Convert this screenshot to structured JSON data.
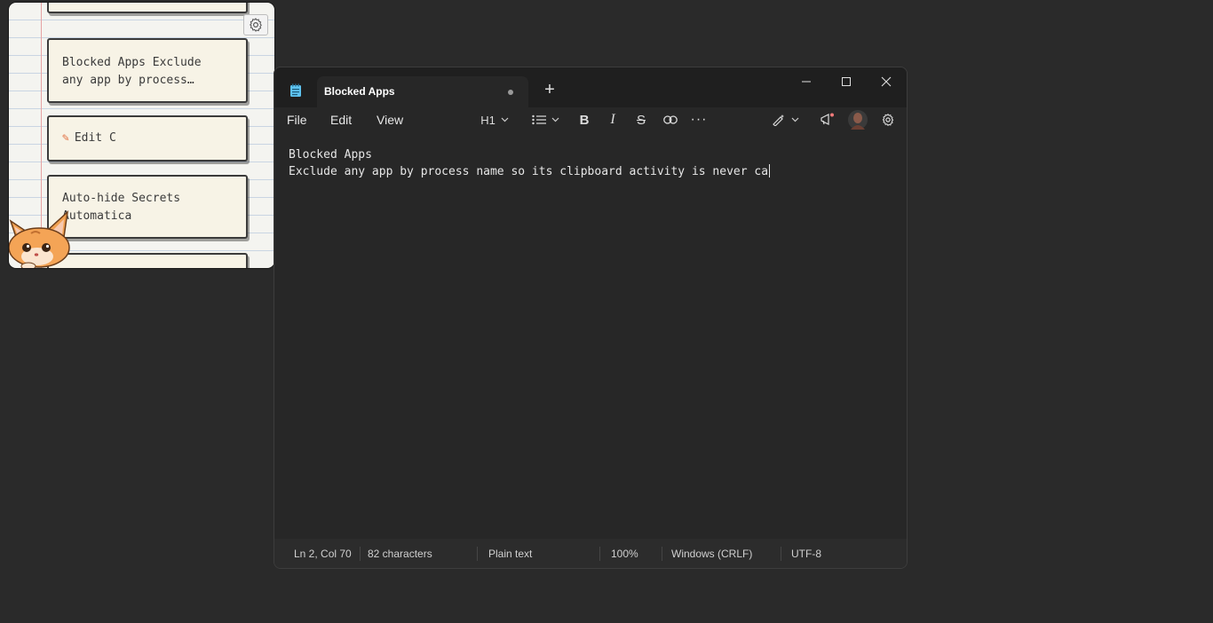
{
  "clipboard": {
    "cards": [
      {
        "line1": "Blocked Apps Exclude",
        "line2": "any app by process…"
      },
      {
        "label": "Edit C"
      },
      {
        "line1": "Auto-hide Secrets",
        "line2": "Automatica"
      }
    ],
    "pencil": "✎"
  },
  "notepad": {
    "tab_title": "Blocked Apps",
    "new_tab": "+",
    "menu": {
      "file": "File",
      "edit": "Edit",
      "view": "View"
    },
    "toolbar": {
      "heading": "H1",
      "bold": "B",
      "italic": "I",
      "strike": "S",
      "more": "···"
    },
    "editor": {
      "line1": "Blocked Apps",
      "line2": "Exclude any app by process name so its clipboard activity is never ca"
    },
    "status": {
      "position": "Ln 2, Col 70",
      "chars": "82 characters",
      "format": "Plain text",
      "zoom": "100%",
      "line_ending": "Windows (CRLF)",
      "encoding": "UTF-8"
    }
  },
  "colors": {
    "accent": "#60cdff",
    "background": "#2a2a2a",
    "pencil": "#e06a3a"
  }
}
